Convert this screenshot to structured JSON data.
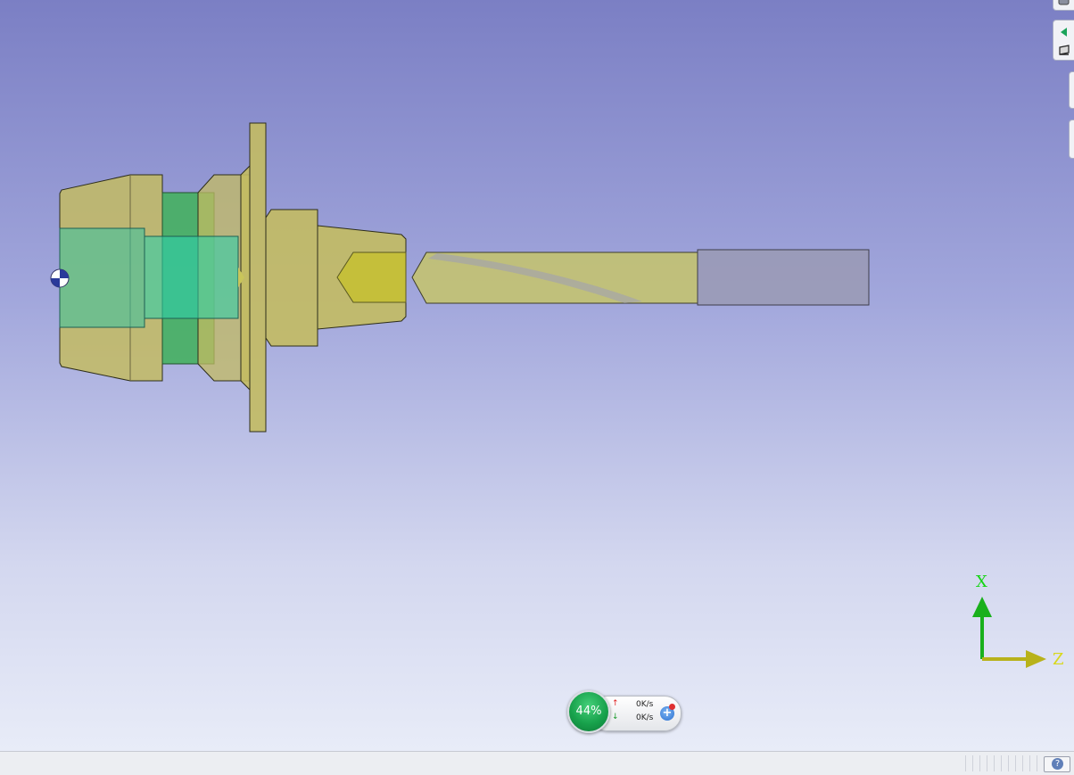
{
  "viewport": {
    "axes": {
      "x_label": "X",
      "z_label": "Z"
    }
  },
  "net_meter": {
    "cpu_percent": "44%",
    "upload_rate": "0K/s",
    "download_rate": "0K/s",
    "boost_symbol": "+"
  },
  "status_bar": {
    "help_symbol": "?"
  },
  "colors": {
    "holder": "#c3bb62",
    "collet": "#3fb98a",
    "drill": "#c5c46a",
    "shank": "#9a9ab4",
    "axis_x": "#15d515",
    "axis_z": "#d8d81a"
  },
  "icons": [
    "camera-icon",
    "nav-left-icon",
    "box-icon",
    "origin-marker-icon",
    "help-icon"
  ]
}
